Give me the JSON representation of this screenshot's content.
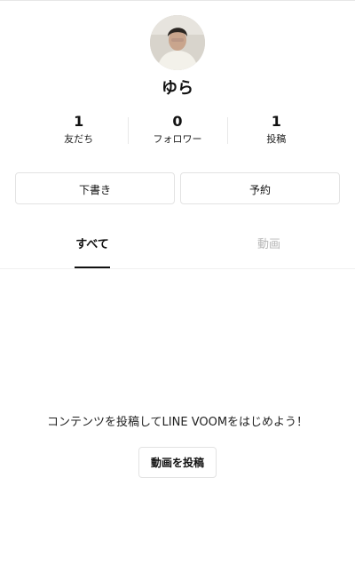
{
  "profile": {
    "name": "ゆら",
    "avatar_icon": "profile-photo-avatar"
  },
  "stats": [
    {
      "value": "1",
      "label": "友だち"
    },
    {
      "value": "0",
      "label": "フォロワー"
    },
    {
      "value": "1",
      "label": "投稿"
    }
  ],
  "actions": {
    "draft_label": "下書き",
    "scheduled_label": "予約"
  },
  "tabs": [
    {
      "label": "すべて",
      "active": true
    },
    {
      "label": "動画",
      "active": false
    }
  ],
  "empty_state": {
    "message": "コンテンツを投稿してLINE VOOMをはじめよう！",
    "button_label": "動画を投稿"
  },
  "colors": {
    "text": "#111111",
    "inactive_tab": "#b7b7b7",
    "border": "#e3e3e3",
    "background": "#ffffff"
  }
}
